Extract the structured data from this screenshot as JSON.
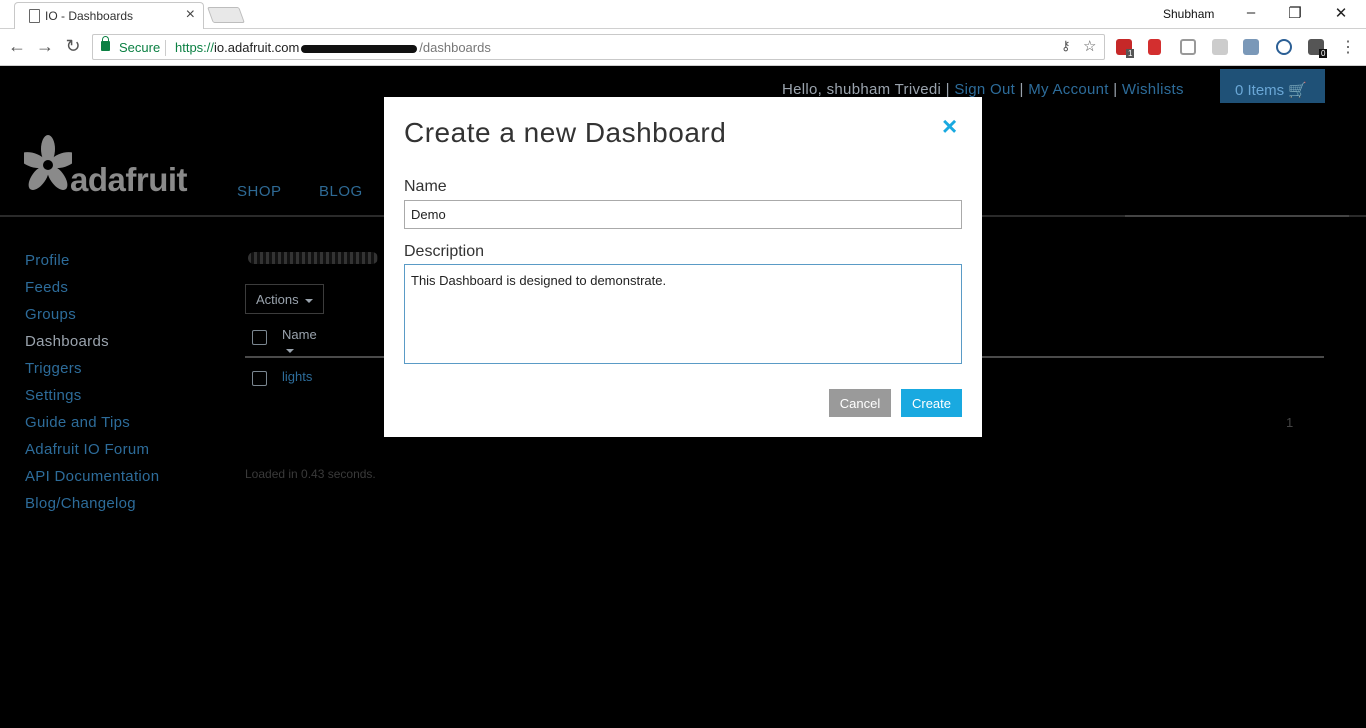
{
  "browser": {
    "tab_title": "IO - Dashboards",
    "user_name": "Shubham",
    "secure_label": "Secure",
    "url_protocol": "https://",
    "url_host": "io.adafruit.com",
    "url_path": "/dashboards",
    "ext_badge_abp": "1",
    "ext_badge_last": "0"
  },
  "header": {
    "greeting": "Hello, shubham Trivedi",
    "sign_out": "Sign Out",
    "my_account": "My Account",
    "wishlists": "Wishlists",
    "cart": "0 Items",
    "logo_text": "adafruit",
    "nav": [
      "SHOP",
      "BLOG"
    ]
  },
  "sidebar": {
    "items": [
      {
        "label": "Profile"
      },
      {
        "label": "Feeds"
      },
      {
        "label": "Groups"
      },
      {
        "label": "Dashboards"
      },
      {
        "label": "Triggers"
      },
      {
        "label": "Settings"
      },
      {
        "label": "Guide and Tips"
      },
      {
        "label": "Adafruit IO Forum"
      },
      {
        "label": "API Documentation"
      },
      {
        "label": "Blog/Changelog"
      }
    ],
    "active": "Dashboards"
  },
  "main": {
    "actions_label": "Actions",
    "column_name": "Name",
    "rows": [
      {
        "name": "lights"
      }
    ],
    "page_number": "1",
    "loaded_text": "Loaded in 0.43 seconds."
  },
  "modal": {
    "title": "Create a new Dashboard",
    "name_label": "Name",
    "name_value": "Demo",
    "description_label": "Description",
    "description_value": "This Dashboard is designed to demonstrate.",
    "cancel_label": "Cancel",
    "create_label": "Create",
    "close_icon": "×"
  },
  "colors": {
    "accent": "#19a9e0",
    "link": "#2d6c9a",
    "cancel": "#9a9a9a",
    "secure": "#0b8043"
  }
}
